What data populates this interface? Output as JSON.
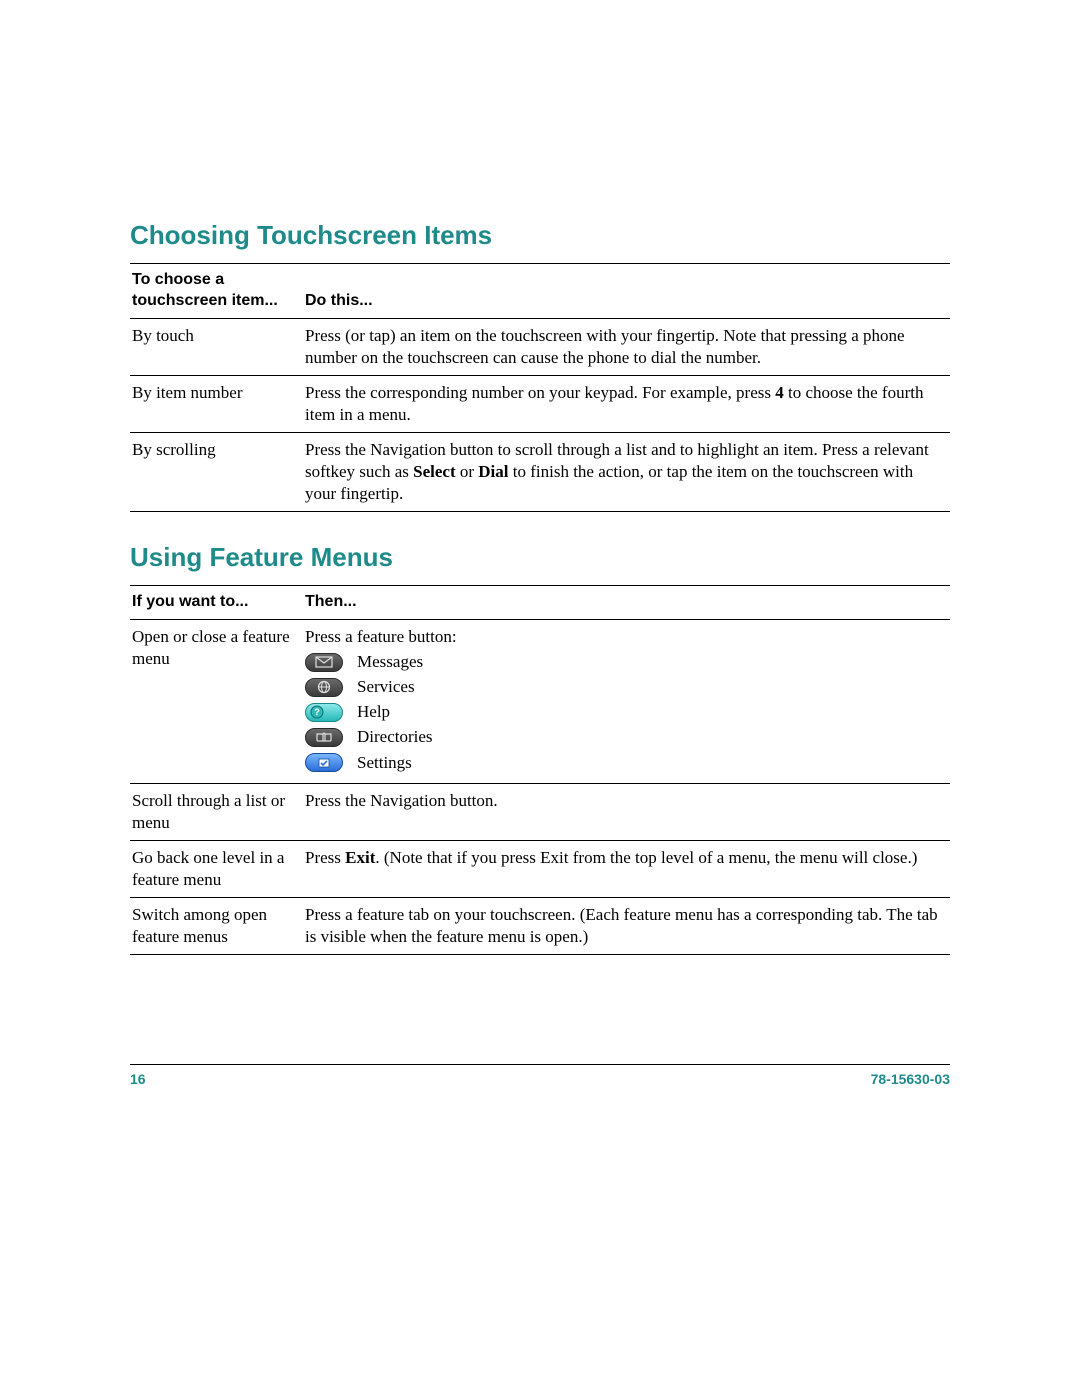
{
  "section1": {
    "heading": "Choosing Touchscreen Items",
    "headers": {
      "c1a": "To choose a",
      "c1b": "touchscreen item...",
      "c2": "Do this..."
    },
    "rows": [
      {
        "c1": "By touch",
        "c2": "Press (or tap) an item on the touchscreen with your fingertip. Note that pressing a phone number on the touchscreen can cause the phone to dial the number."
      },
      {
        "c1": "By item number",
        "c2a": "Press the corresponding number on your keypad. For example, press ",
        "c2b": "4",
        "c2c": " to choose the fourth item in a menu."
      },
      {
        "c1": "By scrolling",
        "c2a": "Press the Navigation button to scroll through a list and to highlight an item. Press a relevant softkey such as ",
        "c2b": "Select",
        "c2c": " or ",
        "c2d": "Dial",
        "c2e": " to finish the action, or tap the item on the touchscreen with your fingertip."
      }
    ]
  },
  "section2": {
    "heading": "Using Feature Menus",
    "headers": {
      "c1": "If you want to...",
      "c2": "Then..."
    },
    "rows": [
      {
        "c1": "Open or close a feature menu",
        "c2_intro": "Press a feature button:",
        "features": [
          {
            "label": "Messages"
          },
          {
            "label": "Services"
          },
          {
            "label": "Help"
          },
          {
            "label": "Directories"
          },
          {
            "label": "Settings"
          }
        ]
      },
      {
        "c1": "Scroll through a list or menu",
        "c2": "Press the Navigation button."
      },
      {
        "c1": "Go back one level in a feature menu",
        "c2a": "Press ",
        "c2b": "Exit",
        "c2c": ". (Note that if you press Exit from the top level of a menu, the menu will close.)"
      },
      {
        "c1": "Switch among open feature menus",
        "c2": "Press a feature tab on your touchscreen. (Each feature menu has a corresponding tab. The tab is visible when the feature menu is open.)"
      }
    ]
  },
  "footer": {
    "page": "16",
    "doc": "78-15630-03"
  }
}
